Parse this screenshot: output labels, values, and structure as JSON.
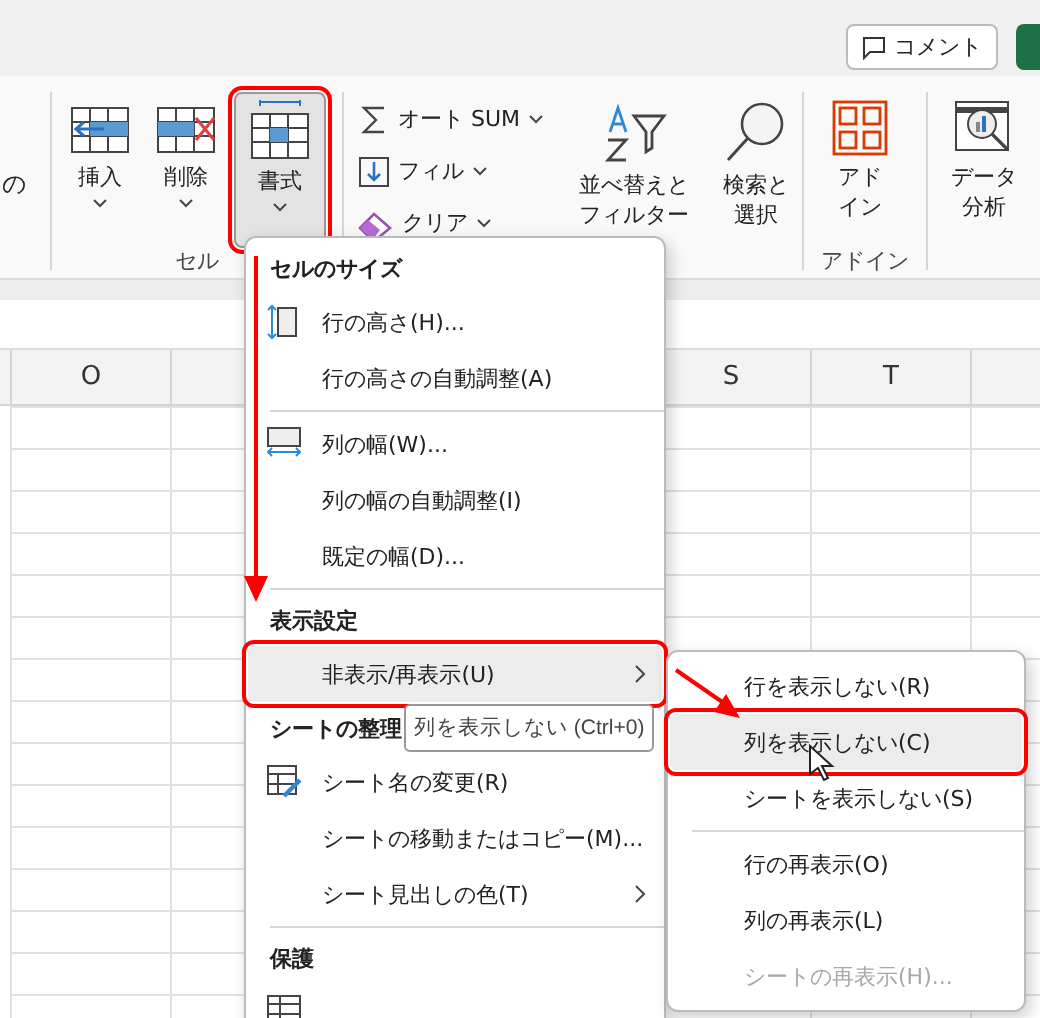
{
  "title_bar": {
    "comment_button": "コメント"
  },
  "ribbon": {
    "partial_group": {
      "text": "の"
    },
    "cells_group": {
      "label": "セル",
      "buttons": [
        {
          "kind": "insert",
          "label": "挿入",
          "selected": false
        },
        {
          "kind": "delete",
          "label": "削除",
          "selected": false
        },
        {
          "kind": "format",
          "label": "書式",
          "selected": true
        }
      ]
    },
    "editing_group": {
      "small_buttons": [
        {
          "kind": "autosum",
          "label": "オート SUM"
        },
        {
          "kind": "fill",
          "label": "フィル"
        },
        {
          "kind": "clear",
          "label": "クリア"
        }
      ],
      "large_buttons": [
        {
          "kind": "sort",
          "lines": [
            "並べ替えと",
            "フィルター"
          ]
        },
        {
          "kind": "find",
          "lines": [
            "検索と",
            "選択"
          ]
        }
      ]
    },
    "addin_group": {
      "label": "アドイン",
      "button": {
        "lines": [
          "アド",
          "イン"
        ]
      }
    },
    "analysis_group": {
      "button": {
        "lines": [
          "データ",
          "分析"
        ]
      }
    }
  },
  "sheet": {
    "column_headers": [
      "O",
      "S",
      "T"
    ]
  },
  "format_menu": {
    "entries": [
      {
        "kind": "heading",
        "text": "セルのサイズ"
      },
      {
        "kind": "row-height",
        "label": "行の高さ(H)...",
        "submenu": false,
        "selected": false
      },
      {
        "kind": "plain",
        "label": "行の高さの自動調整(A)",
        "submenu": false,
        "selected": false
      },
      {
        "kind": "divider"
      },
      {
        "kind": "column-width",
        "label": "列の幅(W)...",
        "submenu": false,
        "selected": false
      },
      {
        "kind": "plain",
        "label": "列の幅の自動調整(I)",
        "submenu": false,
        "selected": false
      },
      {
        "kind": "plain",
        "label": "既定の幅(D)...",
        "submenu": false,
        "selected": false
      },
      {
        "kind": "divider"
      },
      {
        "kind": "heading",
        "text": "表示設定"
      },
      {
        "kind": "plain",
        "label": "非表示/再表示(U)",
        "submenu": true,
        "selected": true
      },
      {
        "kind": "heading",
        "text": "シートの整理"
      },
      {
        "kind": "rename",
        "label": "シート名の変更(R)",
        "submenu": false,
        "selected": false
      },
      {
        "kind": "plain",
        "label": "シートの移動またはコピー(M)...",
        "submenu": false,
        "selected": false
      },
      {
        "kind": "plain",
        "label": "シート見出しの色(T)",
        "submenu": true,
        "selected": false
      },
      {
        "kind": "divider"
      },
      {
        "kind": "heading",
        "text": "保護"
      },
      {
        "kind": "protect",
        "submenu": false,
        "selected": false
      }
    ]
  },
  "submenu": {
    "groups": [
      [
        {
          "label": "行を表示しない(R)",
          "selected": false,
          "disabled": false
        },
        {
          "label": "列を表示しない(C)",
          "selected": true,
          "disabled": false
        },
        {
          "label": "シートを表示しない(S)",
          "selected": false,
          "disabled": false
        }
      ],
      [
        {
          "label": "行の再表示(O)",
          "selected": false,
          "disabled": false
        },
        {
          "label": "列の再表示(L)",
          "selected": false,
          "disabled": false
        },
        {
          "label": "シートの再表示(H)...",
          "selected": false,
          "disabled": true
        }
      ]
    ]
  },
  "tooltip": {
    "text": "列を表示しない (Ctrl+0)"
  }
}
